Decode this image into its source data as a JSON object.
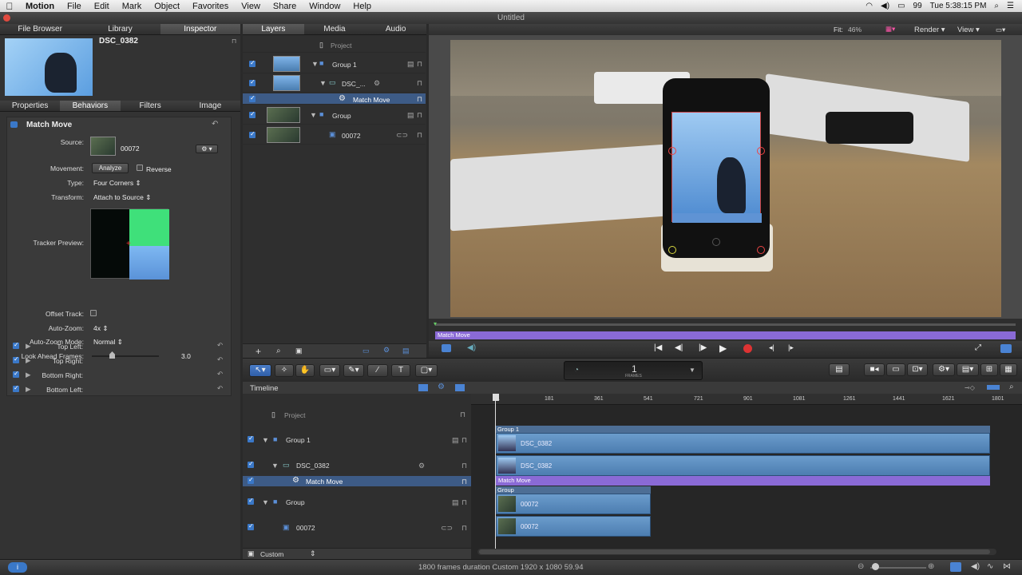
{
  "menubar": {
    "app": "Motion",
    "items": [
      "File",
      "Edit",
      "Mark",
      "Object",
      "Favorites",
      "View",
      "Share",
      "Window",
      "Help"
    ],
    "clock": "Tue 5:38:15 PM",
    "battery": "99"
  },
  "window": {
    "title": "Untitled"
  },
  "left_panel": {
    "tabs": [
      "File Browser",
      "Library",
      "Inspector"
    ],
    "preview_name": "DSC_0382",
    "subtabs": [
      "Properties",
      "Behaviors",
      "Filters",
      "Image"
    ],
    "behavior_title": "Match Move",
    "source_label": "Source:",
    "source_value": "00072",
    "movement_label": "Movement:",
    "analyze_label": "Analyze",
    "reverse_label": "Reverse",
    "type_label": "Type:",
    "type_value": "Four Corners",
    "transform_label": "Transform:",
    "transform_value": "Attach to Source",
    "tracker_preview_label": "Tracker Preview:",
    "offset_track_label": "Offset Track:",
    "auto_zoom_label": "Auto-Zoom:",
    "auto_zoom_value": "4x",
    "auto_zoom_mode_label": "Auto-Zoom Mode:",
    "auto_zoom_mode_value": "Normal",
    "look_ahead_label": "Look Ahead Frames:",
    "look_ahead_value": "3.0",
    "corners": [
      "Top Left:",
      "Top Right:",
      "Bottom Right:",
      "Bottom Left:"
    ]
  },
  "layers_panel": {
    "tabs": [
      "Layers",
      "Media",
      "Audio"
    ],
    "project_label": "Project",
    "rows": [
      {
        "name": "Group 1"
      },
      {
        "name": "DSC_..."
      },
      {
        "name": "Match Move"
      },
      {
        "name": "Group"
      },
      {
        "name": "00072"
      }
    ]
  },
  "canvas_toolbar": {
    "fit_label": "Fit:",
    "fit_value": "46%",
    "render_label": "Render",
    "view_label": "View"
  },
  "mini_timeline": {
    "bar_label": "Match Move"
  },
  "timing_display": {
    "value": "1",
    "unit": "FRAMES"
  },
  "timeline": {
    "title": "Timeline",
    "project_label": "Project",
    "rows": [
      {
        "name": "Group 1"
      },
      {
        "name": "DSC_0382"
      },
      {
        "name": "Match Move"
      },
      {
        "name": "Group"
      },
      {
        "name": "00072"
      }
    ],
    "ruler": [
      "181",
      "361",
      "541",
      "721",
      "901",
      "1081",
      "1261",
      "1441",
      "1621",
      "1801"
    ],
    "ruler_start": "1",
    "tracks": {
      "group1": "Group 1",
      "dsc_a": "DSC_0382",
      "dsc_b": "DSC_0382",
      "match": "Match Move",
      "group": "Group",
      "v_a": "00072",
      "v_b": "00072"
    },
    "footer_select": "Custom"
  },
  "status": {
    "text": "1800 frames duration Custom 1920 x 1080 59.94"
  }
}
